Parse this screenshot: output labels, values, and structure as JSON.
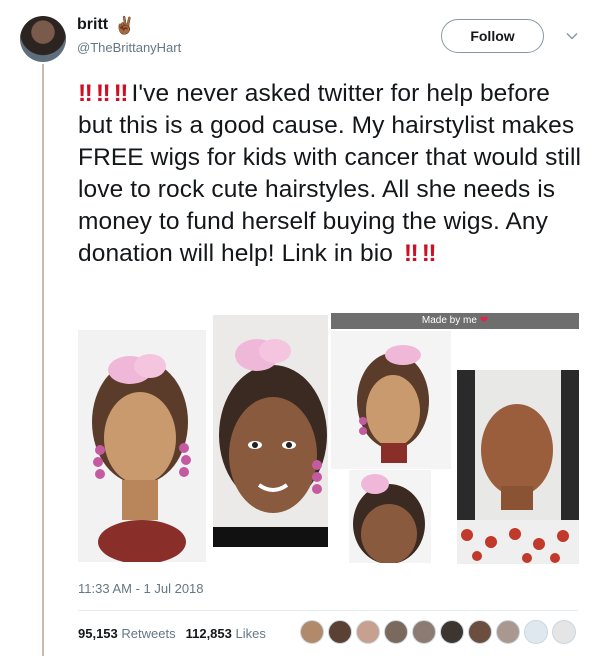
{
  "author": {
    "display_name": "britt",
    "name_emoji": "✌🏾",
    "handle": "@TheBrittanyHart"
  },
  "actions": {
    "follow_label": "Follow"
  },
  "tweet": {
    "emphasis": "‼",
    "text_main": "I've never asked twitter for help before but this is a good cause. My hairstylist makes FREE wigs for kids with cancer that would still love to rock cute hairstyles. All she needs is money to fund herself buying the wigs. Any donation will help! Link in bio"
  },
  "media": {
    "caption": "Made by me",
    "caption_emoji": "❤",
    "photos": [
      "photo-1",
      "photo-2",
      "photo-3",
      "photo-4",
      "photo-5"
    ]
  },
  "meta": {
    "timestamp": "11:33 AM - 1 Jul 2018"
  },
  "stats": {
    "retweets_count": "95,153",
    "retweets_label": "Retweets",
    "likes_count": "112,853",
    "likes_label": "Likes"
  },
  "likers_count_shown": 10,
  "colors": {
    "emphasis_red": "#cc1124",
    "secondary_text": "#657786",
    "primary_text": "#14171a",
    "divider": "#e6ecf0"
  }
}
